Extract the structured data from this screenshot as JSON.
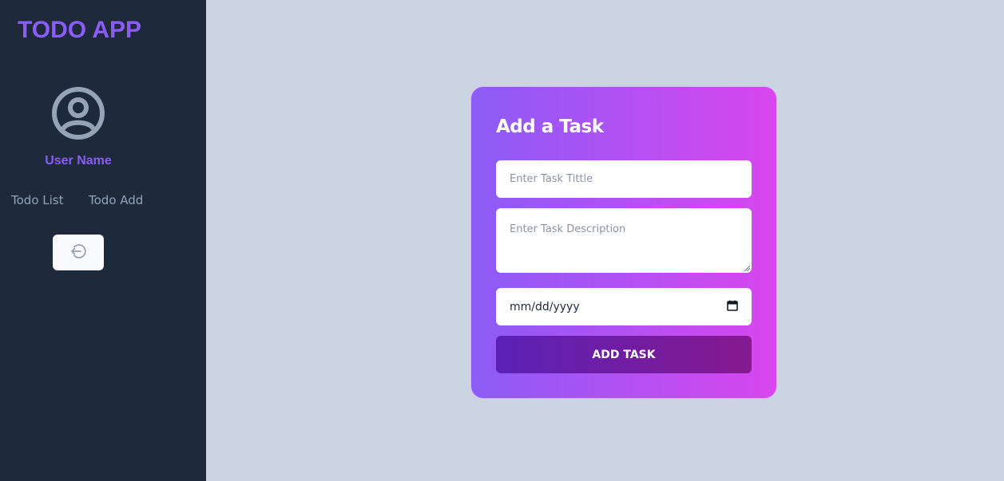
{
  "sidebar": {
    "app_title": "TODO APP",
    "user_name": "User Name",
    "nav": [
      {
        "label": "Todo List"
      },
      {
        "label": "Todo Add"
      }
    ],
    "logout_icon": "logout-icon"
  },
  "form": {
    "heading": "Add a Task",
    "title_placeholder": "Enter Task Tittle",
    "description_placeholder": "Enter Task Description",
    "date_value": "mm/dd/yyyy",
    "submit_label": "ADD TASK"
  },
  "colors": {
    "sidebar_bg": "#1e293b",
    "page_bg": "#cbd5e1",
    "accent": "#8b5cf6",
    "card_gradient_start": "#8b5cf6",
    "card_gradient_end": "#d946ef",
    "button_gradient_start": "#5b21b6",
    "button_gradient_end": "#86198f"
  }
}
